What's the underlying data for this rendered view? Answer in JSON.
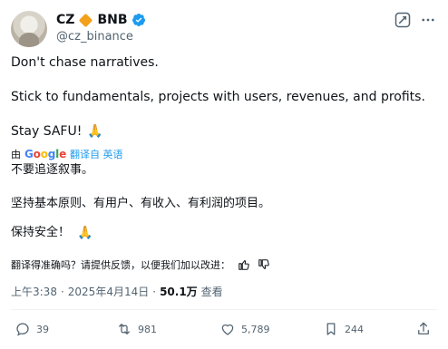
{
  "author": {
    "name": "CZ",
    "badge_text": "BNB",
    "handle": "@cz_binance"
  },
  "tweet": {
    "lines": [
      "Don't chase narratives.",
      "Stick to fundamentals, projects with users, revenues, and profits.",
      "Stay SAFU!"
    ],
    "emoji": "🙏"
  },
  "translation": {
    "by_prefix": "由",
    "provider": "Google",
    "action": "翻译自 英语",
    "lines": [
      "不要追逐叙事。",
      "坚持基本原则、有用户、有收入、有利润的项目。",
      "保持安全！"
    ],
    "emoji": "🙏",
    "feedback_prompt": "翻译得准确吗？请提供反馈，以便我们加以改进："
  },
  "meta": {
    "time": "上午3:38",
    "separator": "·",
    "date": "2025年4月14日",
    "views_count": "50.1万",
    "views_label": "查看"
  },
  "actions": {
    "reply_count": "39",
    "retweet_count": "981",
    "like_count": "5,789",
    "views_count": "244"
  },
  "colors": {
    "text": "#0f1419",
    "secondary": "#536471",
    "accent": "#1d9bf0",
    "bnb": "#f3a11b"
  }
}
